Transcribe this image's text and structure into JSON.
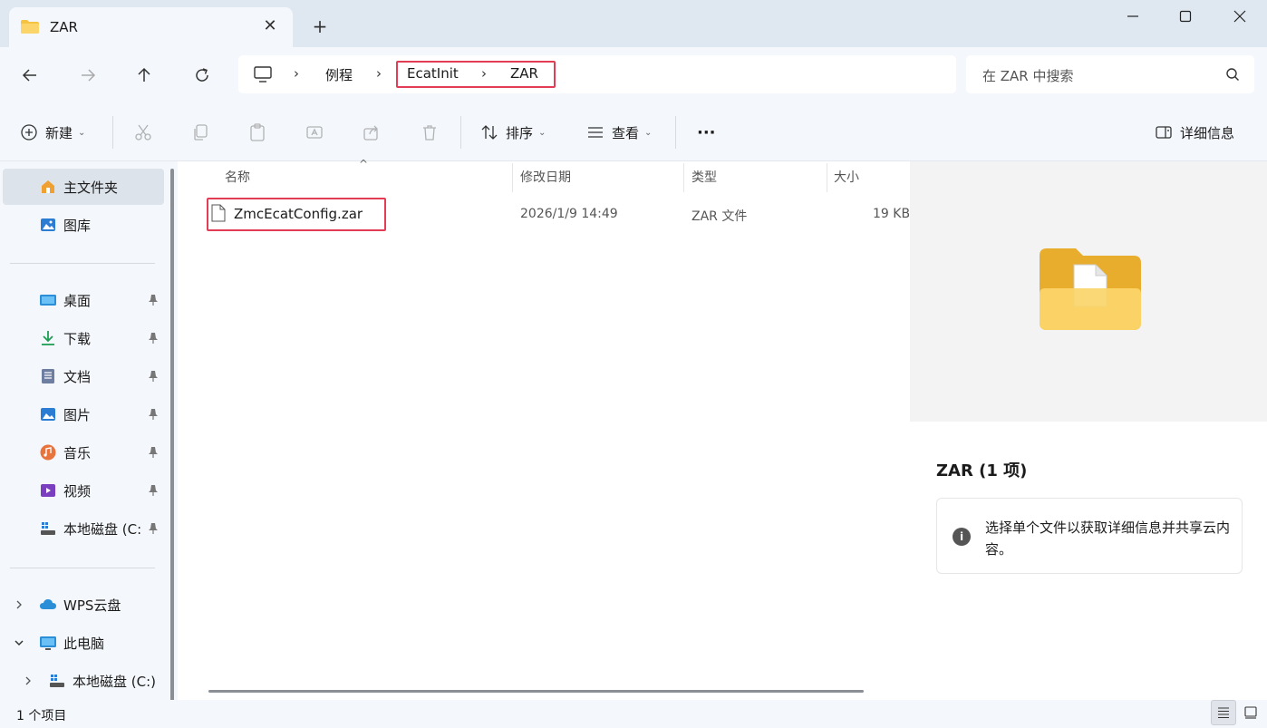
{
  "window": {
    "tab_title": "ZAR",
    "tab_close": "✕",
    "new_tab": "+"
  },
  "navigation": {
    "breadcrumb": [
      "例程",
      "EcatInit",
      "ZAR"
    ],
    "breadcrumb_separator": "›",
    "search_placeholder": "在 ZAR 中搜索"
  },
  "toolbar": {
    "new_label": "新建",
    "sort_label": "排序",
    "view_label": "查看",
    "more_label": "···",
    "details_label": "详细信息"
  },
  "sidebar": {
    "home": "主文件夹",
    "gallery": "图库",
    "quick_access": [
      {
        "label": "桌面",
        "icon": "desktop-icon"
      },
      {
        "label": "下载",
        "icon": "download-icon"
      },
      {
        "label": "文档",
        "icon": "documents-icon"
      },
      {
        "label": "图片",
        "icon": "pictures-icon"
      },
      {
        "label": "音乐",
        "icon": "music-icon"
      },
      {
        "label": "视频",
        "icon": "videos-icon"
      },
      {
        "label": "本地磁盘 (C:",
        "icon": "drive-icon"
      }
    ],
    "wps_cloud": "WPS云盘",
    "this_pc": "此电脑",
    "local_disk": "本地磁盘 (C:)"
  },
  "file_list": {
    "columns": {
      "name": "名称",
      "modified": "修改日期",
      "type": "类型",
      "size": "大小"
    },
    "files": [
      {
        "name": "ZmcEcatConfig.zar",
        "modified": "2026/1/9 14:49",
        "type": "ZAR 文件",
        "size": "19 KB"
      }
    ]
  },
  "preview": {
    "title": "ZAR (1 项)",
    "info_text": "选择单个文件以获取详细信息并共享云内容。",
    "info_glyph": "i"
  },
  "status": {
    "item_count": "1 个项目"
  },
  "colors": {
    "highlight_border": "#e23d54",
    "chrome_bg": "#f4f7fb",
    "tab_strip": "#dfe7f0",
    "folder_yellow": "#f5c242"
  }
}
